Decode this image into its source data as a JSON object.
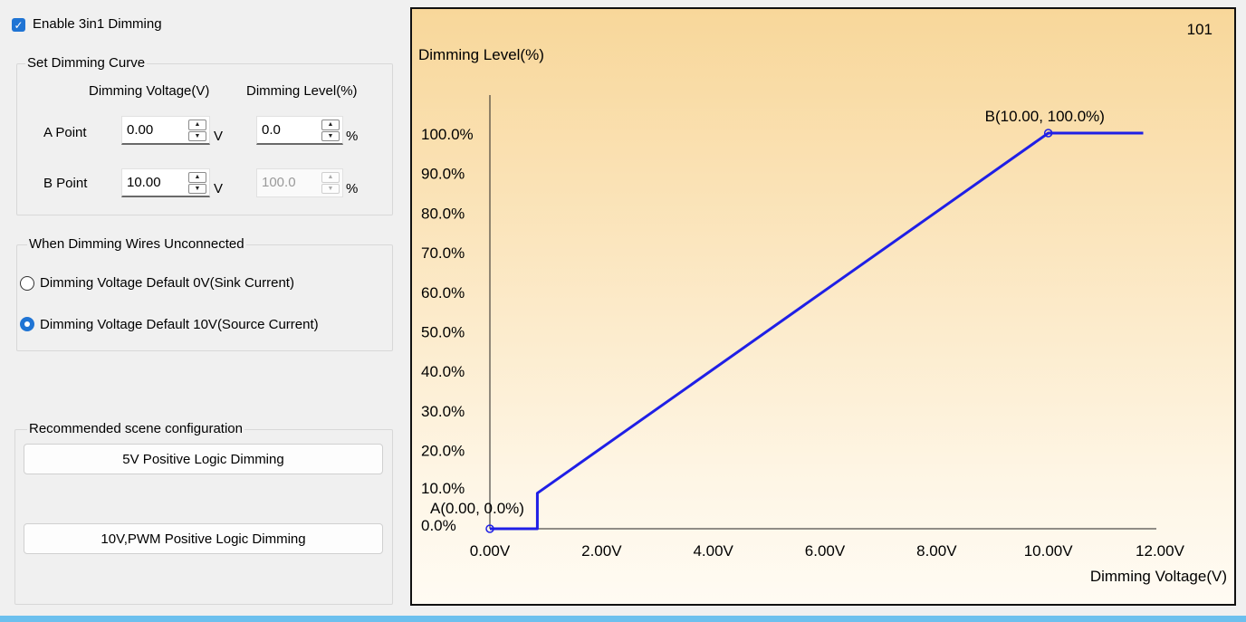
{
  "enable": {
    "label": "Enable 3in1 Dimming",
    "checked": true
  },
  "curve": {
    "title": "Set Dimming Curve",
    "voltage_header": "Dimming Voltage(V)",
    "level_header": "Dimming Level(%)",
    "a_label": "A Point",
    "a_voltage": "0.00",
    "a_level": "0.0",
    "b_label": "B Point",
    "b_voltage": "10.00",
    "b_level": "100.0",
    "unit_v": "V",
    "unit_pct": "%"
  },
  "wires": {
    "title": "When Dimming Wires Unconnected",
    "option_0v": "Dimming Voltage Default 0V(Sink Current)",
    "option_10v": "Dimming Voltage Default 10V(Source Current)",
    "selected": "option_10v"
  },
  "recommend": {
    "title": "Recommended scene configuration",
    "btn_5v": "5V Positive Logic Dimming",
    "btn_10v": "10V,PWM Positive Logic Dimming"
  },
  "chart_data": {
    "type": "line",
    "corner_label": "101",
    "ylabel": "Dimming Level(%)",
    "xlabel": "Dimming Voltage(V)",
    "x_ticks": [
      "0.00V",
      "2.00V",
      "4.00V",
      "6.00V",
      "8.00V",
      "10.00V",
      "12.00V"
    ],
    "x_tick_values": [
      0,
      2,
      4,
      6,
      8,
      10,
      12
    ],
    "y_ticks": [
      "0.0%",
      "10.0%",
      "20.0%",
      "30.0%",
      "40.0%",
      "50.0%",
      "60.0%",
      "70.0%",
      "80.0%",
      "90.0%",
      "100.0%"
    ],
    "y_tick_values": [
      0,
      10,
      20,
      30,
      40,
      50,
      60,
      70,
      80,
      90,
      100
    ],
    "xlim": [
      0,
      12
    ],
    "ylim": [
      0,
      100
    ],
    "series": [
      {
        "x": [
          0,
          0.85,
          0.85,
          0.85,
          10.0,
          11.7
        ],
        "y": [
          0,
          0,
          0,
          9,
          100,
          100
        ]
      }
    ],
    "point_a": {
      "label": "A(0.00, 0.0%)",
      "x": 0,
      "y": 0
    },
    "point_b": {
      "label": "B(10.00, 100.0%)",
      "x": 10,
      "y": 100
    },
    "line_color": "#1f1fe6"
  },
  "colors": {
    "accent": "#1f74d4",
    "bottom_bar": "#6cc0ee"
  }
}
